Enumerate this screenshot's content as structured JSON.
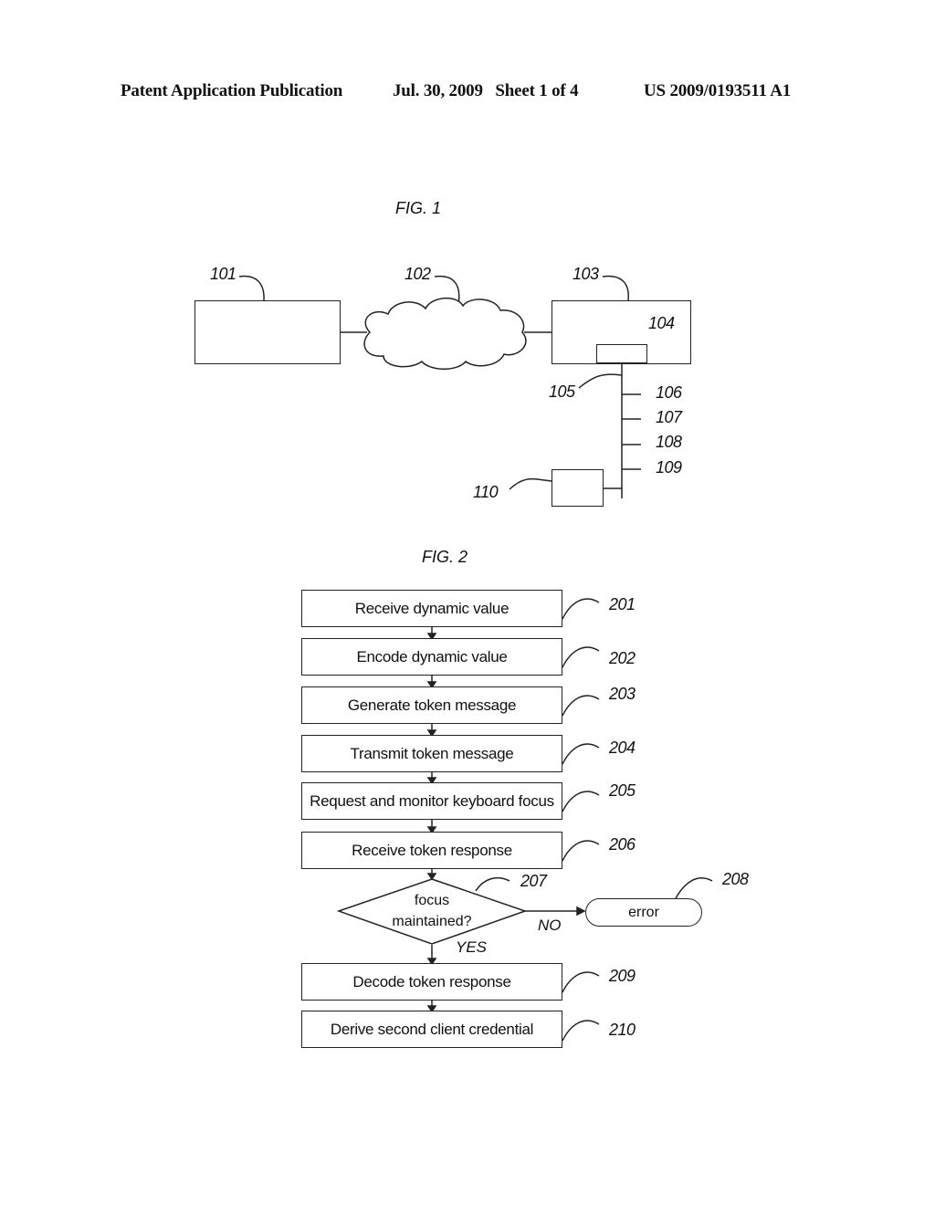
{
  "header": {
    "publication": "Patent Application Publication",
    "date_sheet": "Jul. 30, 2009   Sheet 1 of 4",
    "number": "US 2009/0193511 A1"
  },
  "fig1": {
    "title": "FIG. 1",
    "refs": {
      "r101": "101",
      "r102": "102",
      "r103": "103",
      "r104": "104",
      "r105": "105",
      "r106": "106",
      "r107": "107",
      "r108": "108",
      "r109": "109",
      "r110": "110"
    }
  },
  "fig2": {
    "title": "FIG. 2",
    "steps": [
      {
        "ref": "201",
        "label": "Receive dynamic value"
      },
      {
        "ref": "202",
        "label": "Encode dynamic value"
      },
      {
        "ref": "203",
        "label": "Generate token message"
      },
      {
        "ref": "204",
        "label": "Transmit token message"
      },
      {
        "ref": "205",
        "label": "Request and monitor keyboard focus"
      },
      {
        "ref": "206",
        "label": "Receive token response"
      },
      {
        "ref": "209",
        "label": "Decode token response"
      },
      {
        "ref": "210",
        "label": "Derive second client credential"
      }
    ],
    "decision": {
      "ref": "207",
      "line1": "focus",
      "line2": "maintained?",
      "no_label": "NO",
      "yes_label": "YES"
    },
    "terminal": {
      "ref": "208",
      "label": "error"
    }
  }
}
